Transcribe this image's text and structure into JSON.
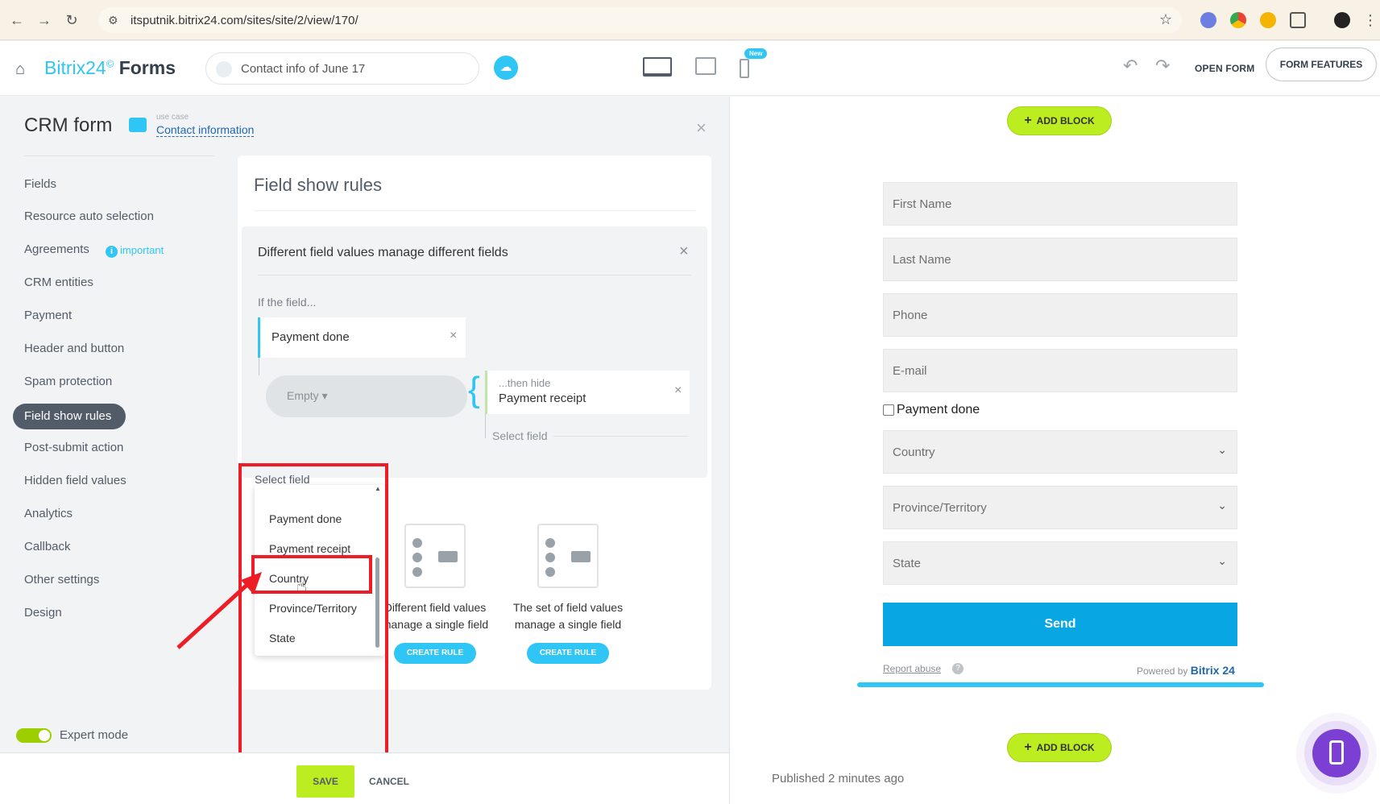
{
  "browser": {
    "url": "itsputnik.bitrix24.com/sites/site/2/view/170/"
  },
  "header": {
    "logo_main": "Bitrix24",
    "logo_mark": "©",
    "logo_forms": "Forms",
    "form_name": "Contact info of June 17",
    "new_badge": "New",
    "open_form": "OPEN FORM",
    "form_features": "FORM FEATURES"
  },
  "left": {
    "title": "CRM form",
    "use_case_caption": "use case",
    "use_case_link": "Contact information",
    "menu": [
      "Fields",
      "Resource auto selection",
      "Agreements",
      "CRM entities",
      "Payment",
      "Header and button",
      "Spam protection",
      "Field show rules",
      "Post-submit action",
      "Hidden field values",
      "Analytics",
      "Callback",
      "Other settings",
      "Design"
    ],
    "important_badge": "important",
    "expert_mode": "Expert mode"
  },
  "rules": {
    "title": "Field show rules",
    "rule_box_title": "Different field values manage different fields",
    "if_field_label": "If the field...",
    "field_chip": "Payment done",
    "empty_value": "Empty",
    "then_hide_caption": "...then hide",
    "then_hide_field": "Payment receipt",
    "select_field_right": "Select field",
    "select_field_label": "Select field",
    "dropdown_items": [
      "Payment done",
      "Payment receipt",
      "Country",
      "Province/Territory",
      "State"
    ],
    "rule_types": [
      {
        "partial_line1": "s",
        "partial_line2": "ds"
      },
      {
        "line1": "Different field values",
        "line2": "manage a single field",
        "button": "CREATE RULE"
      },
      {
        "line1": "The set of field values",
        "line2": "manage a single field",
        "button": "CREATE RULE"
      }
    ]
  },
  "footer": {
    "save": "SAVE",
    "cancel": "CANCEL"
  },
  "preview": {
    "add_block": "ADD BLOCK",
    "fields": [
      "First Name",
      "Last Name",
      "Phone",
      "E-mail"
    ],
    "checkbox_label": "Payment done",
    "selects": [
      "Country",
      "Province/Territory",
      "State"
    ],
    "send": "Send",
    "report_abuse": "Report abuse",
    "powered_by": "Powered by",
    "powered_brand": "Bitrix 24",
    "published": "Published 2 minutes ago"
  },
  "colors": {
    "accent": "#2fc6f6",
    "save_green": "#bbed21",
    "send_blue": "#08a6e2",
    "highlight_red": "#ee1c25",
    "fab_purple": "#7c3fd4"
  }
}
